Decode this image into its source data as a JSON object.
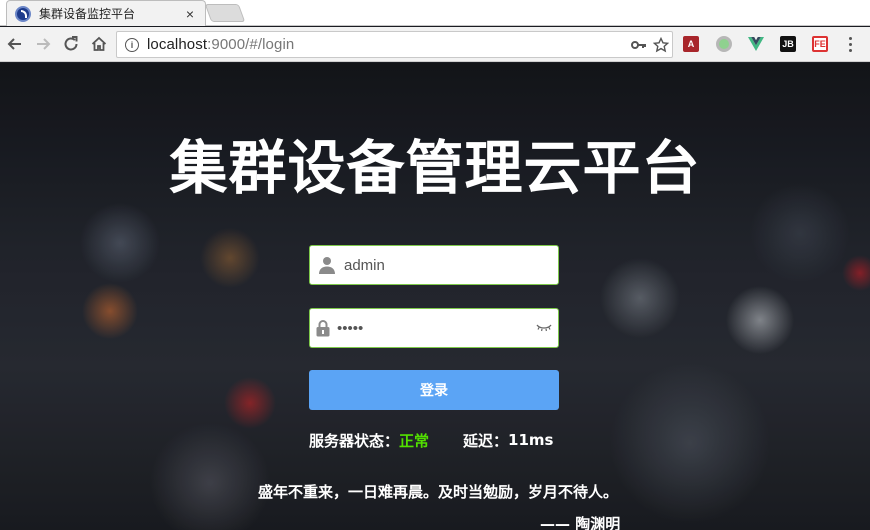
{
  "browser": {
    "tab_title": "集群设备监控平台",
    "tab_close": "×",
    "url_host": "localhost",
    "url_rest": ":9000/#/login",
    "extensions": {
      "a_label": "A",
      "jb_label": "JB",
      "fe_label": "FE"
    }
  },
  "page": {
    "title": "集群设备管理云平台",
    "username": {
      "value": "admin",
      "icon": "user-icon"
    },
    "password": {
      "value": "•••••",
      "icon": "lock-icon"
    },
    "login_label": "登录",
    "status": {
      "label": "服务器状态：",
      "value": "正常",
      "latency_label": "延迟：",
      "latency_value": "11ms"
    },
    "quote": "盛年不重来，一日难再晨。及时当勉励，岁月不待人。",
    "quote_author": "—— 陶渊明"
  },
  "colors": {
    "status_ok": "#52e000",
    "button": "#5ba4f5",
    "field_border": "#7ec94a"
  }
}
